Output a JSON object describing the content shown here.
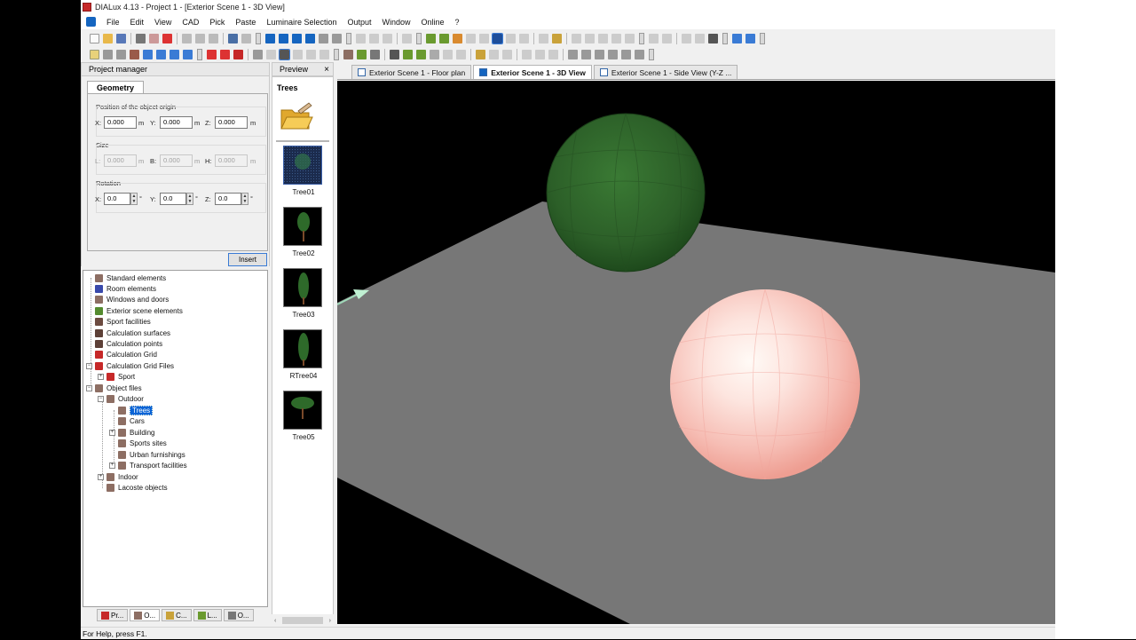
{
  "window": {
    "title": "DIALux 4.13 - Project 1 - [Exterior Scene 1 - 3D View]"
  },
  "menu": [
    "File",
    "Edit",
    "View",
    "CAD",
    "Pick",
    "Paste",
    "Luminaire Selection",
    "Output",
    "Window",
    "Online",
    "?"
  ],
  "project_manager": {
    "header": "Project manager",
    "tab": "Geometry",
    "position": {
      "label": "Position of the object origin",
      "x_label": "X:",
      "x": "0.000",
      "y_label": "Y:",
      "y": "0.000",
      "z_label": "Z:",
      "z": "0.000",
      "unit": "m"
    },
    "size": {
      "label": "Size",
      "l_label": "L:",
      "l": "0.000",
      "b_label": "B:",
      "b": "0.000",
      "h_label": "H:",
      "h": "0.000",
      "unit": "m"
    },
    "rotation": {
      "label": "Rotation",
      "x_label": "X:",
      "x": "0.0",
      "y_label": "Y:",
      "y": "0.0",
      "z_label": "Z:",
      "z": "0.0",
      "unit": "°"
    },
    "insert_label": "Insert"
  },
  "tree": {
    "items": [
      {
        "label": "Standard elements",
        "icon_color": "#8d6e63"
      },
      {
        "label": "Room elements",
        "icon_color": "#3949ab"
      },
      {
        "label": "Windows and doors",
        "icon_color": "#8d6e63"
      },
      {
        "label": "Exterior scene elements",
        "icon_color": "#558b2f"
      },
      {
        "label": "Sport facilities",
        "icon_color": "#6d4c41"
      },
      {
        "label": "Calculation surfaces",
        "icon_color": "#5d4037"
      },
      {
        "label": "Calculation points",
        "icon_color": "#5d4037"
      },
      {
        "label": "Calculation Grid",
        "icon_color": "#c62828"
      },
      {
        "label": "Calculation Grid Files",
        "icon_color": "#c62828"
      },
      {
        "label": "Sport",
        "icon_color": "#c62828"
      },
      {
        "label": "Object files",
        "icon_color": "#8d6e63"
      },
      {
        "label": "Outdoor",
        "icon_color": "#8d6e63"
      },
      {
        "label": "Trees",
        "icon_color": "#8d6e63"
      },
      {
        "label": "Cars",
        "icon_color": "#8d6e63"
      },
      {
        "label": "Building",
        "icon_color": "#8d6e63"
      },
      {
        "label": "Sports sites",
        "icon_color": "#8d6e63"
      },
      {
        "label": "Urban furnishings",
        "icon_color": "#8d6e63"
      },
      {
        "label": "Transport facilities",
        "icon_color": "#8d6e63"
      },
      {
        "label": "Indoor",
        "icon_color": "#8d6e63"
      },
      {
        "label": "Lacoste objects",
        "icon_color": "#8d6e63"
      }
    ],
    "selected": "Trees"
  },
  "bottom_tabs": [
    "Pr...",
    "O...",
    "C...",
    "L...",
    "O..."
  ],
  "status": "For Help, press F1.",
  "preview": {
    "header": "Preview",
    "close_glyph": "×",
    "title": "Trees",
    "items": [
      {
        "label": "Tree01"
      },
      {
        "label": "Tree02"
      },
      {
        "label": "Tree03"
      },
      {
        "label": "RTree04"
      },
      {
        "label": "Tree05"
      }
    ],
    "scroll_left": "‹",
    "scroll_right": "›"
  },
  "doc_tabs": [
    {
      "label": "Exterior Scene 1 - Floor plan",
      "active": false
    },
    {
      "label": "Exterior Scene 1 - 3D View",
      "active": true
    },
    {
      "label": "Exterior Scene 1 - Side View (Y-Z ...",
      "active": false
    }
  ],
  "colors": {
    "ground": "#7a7a7a",
    "tree_sphere": "#2e5e2a",
    "lamp_sphere": "#f5c2bc",
    "accent": "#0a64d6"
  }
}
